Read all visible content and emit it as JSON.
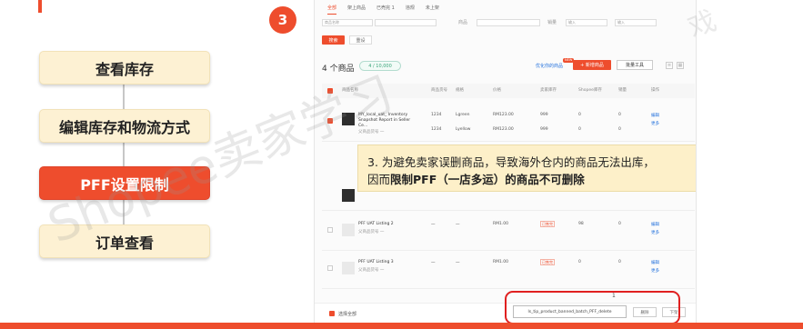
{
  "flow_steps": [
    {
      "label": "查看库存",
      "active": false
    },
    {
      "label": "编辑库存和物流方式",
      "active": false
    },
    {
      "label": "PFF设置限制",
      "active": true
    },
    {
      "label": "订单查看",
      "active": false
    }
  ],
  "step_badge": "3",
  "screenshot": {
    "tabs": [
      "全部",
      "架上商品",
      "已売完 1",
      "违规",
      "未上架"
    ],
    "filters": {
      "label_1": "商品名称",
      "label_2": "商品",
      "label_3": "销量",
      "placeholder_min": "输入",
      "placeholder_max": "输入"
    },
    "search_label": "搜索",
    "reset_label": "重设",
    "product_count": "4 个商品",
    "count_badge": "4 / 10,000",
    "optimize_link": "优化你的商品",
    "new_tag": "NEW",
    "add_product_label": "+ 新增商品",
    "batch_tools_label": "批量工具",
    "table_headers": [
      "商品名称",
      "商品货号",
      "规格",
      "价格",
      "卖家库存",
      "Shopee库存",
      "销量",
      "操作"
    ],
    "rows": [
      {
        "name": "MY_local_uat_ Inventory Snapshot Report in Seller Ce...",
        "sub": "父商品货号 一",
        "variants": [
          {
            "sku": "1234",
            "variation": "Lgreen",
            "price": "RM123.00",
            "seller_stock": "999",
            "shopee_stock": "0",
            "sales": "0"
          },
          {
            "sku": "1234",
            "variation": "Lyellow",
            "price": "RM123.00",
            "seller_stock": "999",
            "shopee_stock": "0",
            "sales": "0"
          }
        ],
        "actions": [
          "编辑",
          "更多"
        ]
      },
      {
        "name": "PFF UAT Listing 2",
        "sub": "父商品货号 一",
        "sku": "一",
        "variation": "一",
        "price": "RM1.00",
        "tag": "已售完",
        "shopee_stock": "98",
        "sales": "0",
        "actions": [
          "编辑",
          "更多"
        ]
      },
      {
        "name": "PFF UAT Listing 3",
        "sub": "父商品货号 一",
        "sku": "一",
        "variation": "一",
        "price": "RM1.00",
        "tag": "已售完",
        "shopee_stock": "0",
        "sales": "0",
        "actions": [
          "编辑",
          "更多"
        ]
      }
    ],
    "select_all_label": "选择全部",
    "pagination": "1",
    "tooltip_text": "ls_tip_product_banned_batch_PFF_delete",
    "delete_label": "删除",
    "next_label": "下架"
  },
  "callout": {
    "line1": "3. 为避免卖家误删商品，导致海外仓内的商品无法出库，",
    "line2_prefix": "因而",
    "line2_bold": "限制PFF（一店多运）的商品不可删除"
  },
  "watermark": "Shopee卖家学习",
  "watermark_tail": "戏",
  "colors": {
    "accent": "#ee4d2d",
    "callout_bg": "#fdf0c9",
    "step_bg": "#fdf1d3",
    "highlight": "#e02020"
  }
}
